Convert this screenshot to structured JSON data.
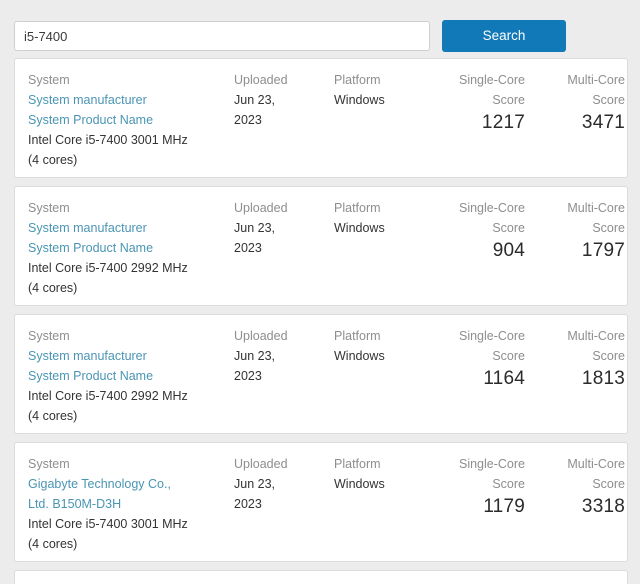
{
  "search": {
    "value": "i5-7400",
    "placeholder": "Search",
    "button_label": "Search"
  },
  "colors": {
    "accent": "#1179b7",
    "link": "#4a95b4",
    "page_background": "#ececec",
    "card_background": "#ffffff",
    "card_border": "#dcdcdc",
    "header_text": "#8e8e8e"
  },
  "columns": {
    "system": "System",
    "uploaded": "Uploaded",
    "platform": "Platform",
    "single_core_line1": "Single-Core",
    "single_core_line2": "Score",
    "multi_core_line1": "Multi-Core",
    "multi_core_line2": "Score"
  },
  "results": [
    {
      "manufacturer": "System manufacturer",
      "product": "System Product Name",
      "cpu": "Intel Core i5-7400 3001 MHz",
      "cores": "(4 cores)",
      "uploaded": "Jun 23, 2023",
      "platform": "Windows",
      "single_core": "1217",
      "multi_core": "3471"
    },
    {
      "manufacturer": "System manufacturer",
      "product": "System Product Name",
      "cpu": "Intel Core i5-7400 2992 MHz",
      "cores": "(4 cores)",
      "uploaded": "Jun 23, 2023",
      "platform": "Windows",
      "single_core": "904",
      "multi_core": "1797"
    },
    {
      "manufacturer": "System manufacturer",
      "product": "System Product Name",
      "cpu": "Intel Core i5-7400 2992 MHz",
      "cores": "(4 cores)",
      "uploaded": "Jun 23, 2023",
      "platform": "Windows",
      "single_core": "1164",
      "multi_core": "1813"
    },
    {
      "manufacturer": "Gigabyte Technology Co.,",
      "product": "Ltd. B150M-D3H",
      "cpu": "Intel Core i5-7400 3001 MHz",
      "cores": "(4 cores)",
      "uploaded": "Jun 23, 2023",
      "platform": "Windows",
      "single_core": "1179",
      "multi_core": "3318"
    }
  ]
}
